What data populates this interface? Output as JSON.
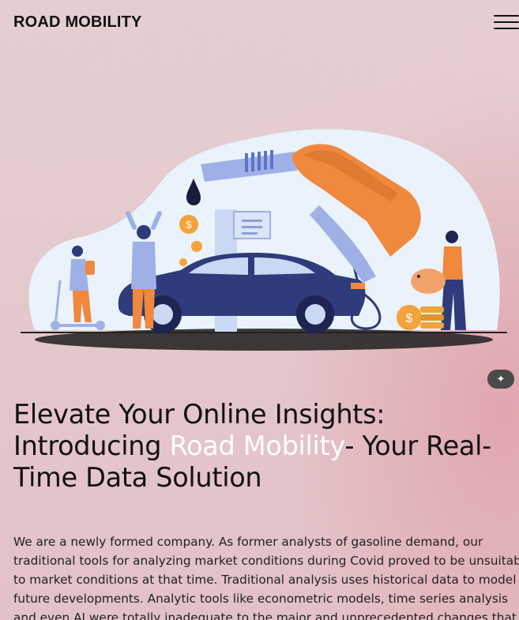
{
  "header": {
    "brand": "ROAD MOBILITY",
    "menu_icon": "hamburger-menu-icon"
  },
  "hero": {
    "illustration_icon": "fuel-pump-car-illustration",
    "ai_badge_icon": "magic-wand-icon",
    "headline": {
      "line1": "Elevate Your Online Insights:",
      "line2_prefix": "Introducing ",
      "line2_highlight": "Road Mobility",
      "line2_suffix": "- Your Real-",
      "line3": "Time Data Solution"
    },
    "intro_lines": [
      "We are a newly formed company. As former analysts of gasoline demand, our",
      "traditional tools for analyzing market conditions during Covid proved to be unsuitable",
      "to market conditions at that time. Traditional analysis uses historical data to model",
      "future developments. Analytic tools like econometric models, time series analysis",
      "and even AI were totally inadequate to the major and unprecedented changes that"
    ]
  },
  "colors": {
    "text": "#111111",
    "highlight": "#ffffff",
    "car": "#2f3b7a",
    "nozzle": "#f0883e",
    "blob": "#eaf3fb",
    "coin": "#f2a33a"
  }
}
